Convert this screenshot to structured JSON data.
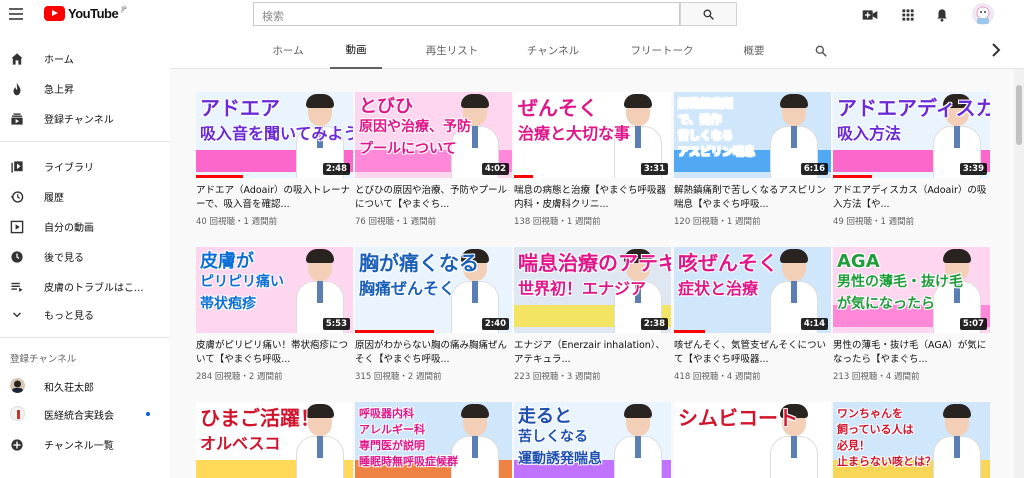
{
  "header": {
    "logo_text": "YouTube",
    "logo_region": "JP",
    "search_placeholder": "検索",
    "icons": [
      "menu-icon",
      "search-icon",
      "video-camera-icon",
      "apps-grid-icon",
      "bell-icon",
      "account-avatar"
    ]
  },
  "sidebar": {
    "items": [
      {
        "label": "ホーム",
        "icon": "home-icon",
        "active": false
      },
      {
        "label": "急上昇",
        "icon": "flame-icon",
        "active": false
      },
      {
        "label": "登録チャンネル",
        "icon": "subscriptions-icon",
        "active": false
      },
      {
        "label": "ライブラリ",
        "icon": "library-icon",
        "active": false
      },
      {
        "label": "履歴",
        "icon": "history-icon",
        "active": false
      },
      {
        "label": "自分の動画",
        "icon": "play-box-icon",
        "active": false
      },
      {
        "label": "後で見る",
        "icon": "clock-icon",
        "active": false
      },
      {
        "label": "皮膚のトラブルはこ...",
        "icon": "playlist-icon",
        "active": false
      },
      {
        "label": "もっと見る",
        "icon": "chevron-down-icon",
        "active": false
      }
    ],
    "subscriptions_heading": "登録チャンネル",
    "subscriptions": [
      {
        "label": "和久荘太郎",
        "new": false
      },
      {
        "label": "医経統合実践会",
        "new": true
      },
      {
        "label": "チャンネル一覧",
        "new": false
      }
    ]
  },
  "tabs": [
    {
      "label": "ホーム",
      "active": false
    },
    {
      "label": "動画",
      "active": true
    },
    {
      "label": "再生リスト",
      "active": false
    },
    {
      "label": "チャンネル",
      "active": false
    },
    {
      "label": "フリートーク",
      "active": false
    },
    {
      "label": "概要",
      "active": false
    }
  ],
  "videos": [
    {
      "title": "アドエア（Adoair）の吸入トレーナーで、吸入音を確認...",
      "meta": "40 回視聴・1 週間前",
      "duration": "2:48",
      "thumb_text": [
        "アドエア",
        "吸入音を聞いてみよう"
      ],
      "thumb_bg": "#eaf4ff",
      "progress": 0.3
    },
    {
      "title": "とびひの原因や治療、予防やプールについて【やまぐち...",
      "meta": "76 回視聴・1 週間前",
      "duration": "4:02",
      "thumb_text": [
        "とびひ",
        "原因や治療、予防",
        "プールについて"
      ],
      "thumb_bg": "#ffd6f0",
      "progress": 0
    },
    {
      "title": "喘息の病態と治療【やまぐち呼吸器内科・皮膚科クリニ...",
      "meta": "138 回視聴・1 週間前",
      "duration": "3:31",
      "thumb_text": [
        "ぜんそく",
        "治療と大切な事"
      ],
      "thumb_bg": "#fff",
      "progress": 0.12
    },
    {
      "title": "解熱鎮痛剤で苦しくなるアスピリン喘息【やまぐち呼吸...",
      "meta": "120 回視聴・1 週間前",
      "duration": "6:16",
      "thumb_text": [
        "解熱鎮痛剤",
        "で、発作",
        "苦しくなる",
        "アスピリン喘息"
      ],
      "thumb_bg": "#cfe6fb",
      "progress": 0
    },
    {
      "title": "アドエアディスカス（Adoair）の吸入方法【や...",
      "meta": "49 回視聴・1 週間前",
      "duration": "3:39",
      "thumb_text": [
        "アドエアディスカス",
        "吸入方法"
      ],
      "thumb_bg": "#eaf4ff",
      "progress": 0.25
    },
    {
      "title": "皮膚がピリピリ痛い！帯状疱疹について【やまぐち呼吸...",
      "meta": "284 回視聴・2 週間前",
      "duration": "5:53",
      "thumb_text": [
        "皮膚が",
        "ピリピリ痛い",
        "帯状疱疹"
      ],
      "thumb_bg": "#ffd6f0",
      "progress": 0
    },
    {
      "title": "原因がわからない胸の痛み胸痛ぜんそく【やまぐち呼吸...",
      "meta": "315 回視聴・2 週間前",
      "duration": "2:40",
      "thumb_text": [
        "胸が痛くなる",
        "胸痛ぜんそく"
      ],
      "thumb_bg": "#eaf4ff",
      "progress": 0.5
    },
    {
      "title": "エナジア（Enerzair inhalation）、アテキュラ...",
      "meta": "223 回視聴・3 週間前",
      "duration": "2:38",
      "thumb_text": [
        "喘息治療のアテキュラ",
        "世界初！エナジア"
      ],
      "thumb_bg": "#dfe8f2",
      "progress": 0
    },
    {
      "title": "咳ぜんそく、気管支ぜんそくについて【やまぐち呼吸器...",
      "meta": "418 回視聴・4 週間前",
      "duration": "4:14",
      "thumb_text": [
        "咳ぜんそく",
        "症状と治療"
      ],
      "thumb_bg": "#cfe6fb",
      "progress": 0.2
    },
    {
      "title": "男性の薄毛・抜け毛（AGA）が気になったら【やまぐち...",
      "meta": "213 回視聴・4 週間前",
      "duration": "5:07",
      "thumb_text": [
        "AGA",
        "男性の薄毛・抜け毛",
        "が気になったら"
      ],
      "thumb_bg": "#ffd6f0",
      "progress": 0
    },
    {
      "title": "",
      "meta": "",
      "duration": "",
      "thumb_text": [
        "ひまご活躍！",
        "オルベスコ"
      ],
      "thumb_bg": "#fff",
      "progress": 0
    },
    {
      "title": "",
      "meta": "",
      "duration": "",
      "thumb_text": [
        "呼吸器内科",
        "アレルギー科",
        "専門医が説明",
        "睡眠時無呼吸症候群"
      ],
      "thumb_bg": "#cfe6fb",
      "progress": 0
    },
    {
      "title": "",
      "meta": "",
      "duration": "",
      "thumb_text": [
        "走ると",
        "苦しくなる",
        "運動誘発喘息"
      ],
      "thumb_bg": "#eaf4ff",
      "progress": 0
    },
    {
      "title": "",
      "meta": "",
      "duration": "",
      "thumb_text": [
        "シムビコート"
      ],
      "thumb_bg": "#fff",
      "progress": 0
    },
    {
      "title": "",
      "meta": "",
      "duration": "",
      "thumb_text": [
        "ワンちゃんを",
        "飼っている人は",
        "必見！",
        "止まらない咳とは？"
      ],
      "thumb_bg": "#cfe6fb",
      "progress": 0
    }
  ]
}
